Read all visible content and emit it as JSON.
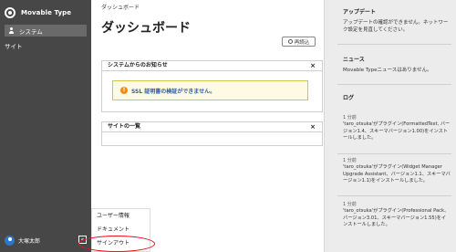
{
  "sidebar": {
    "brand": "Movable Type",
    "system_label": "システム",
    "site_label": "サイト",
    "user_name": "大塚太郎",
    "user_menu_toggle": "«"
  },
  "main": {
    "breadcrumb": "ダッシュボード",
    "title": "ダッシュボード",
    "reread_label": "再読込",
    "notice_panel": {
      "title": "システムからのお知らせ",
      "close": "×",
      "warning_text": "SSL 証明書の検証ができません。"
    },
    "sites_panel": {
      "title": "サイトの一覧",
      "close": "×"
    }
  },
  "user_menu": {
    "items": [
      "ユーザー情報",
      "ドキュメント",
      "サインアウト"
    ]
  },
  "right": {
    "update": {
      "title": "アップデート",
      "text": "アップデートの確認ができません。ネットワーク設定を見直してください。"
    },
    "news": {
      "title": "ニュース",
      "text": "Movable Typeニュースはありません。"
    },
    "log": {
      "title": "ログ",
      "entries": [
        {
          "time": "1 分前",
          "text": "'taro_otsuka'がプラグイン(FormattedText, バージョン1.4、スキーマバージョン1.00)をインストールしました。"
        },
        {
          "time": "1 分前",
          "text": "'taro_otsuka'がプラグイン(Widget Manager Upgrade Assistant、バージョン1.1、スキーマバージョン1.1)をインストールしました。"
        },
        {
          "time": "1 分前",
          "text": "'taro_otsuka'がプラグイン(Professional Pack、バージョン3.01、スキーマバージョン1.55)をインストールしました。"
        }
      ]
    }
  },
  "colors": {
    "sidebar_bg": "#474747",
    "warning_link": "#2a5db0",
    "highlight_ring": "#e0141e"
  }
}
